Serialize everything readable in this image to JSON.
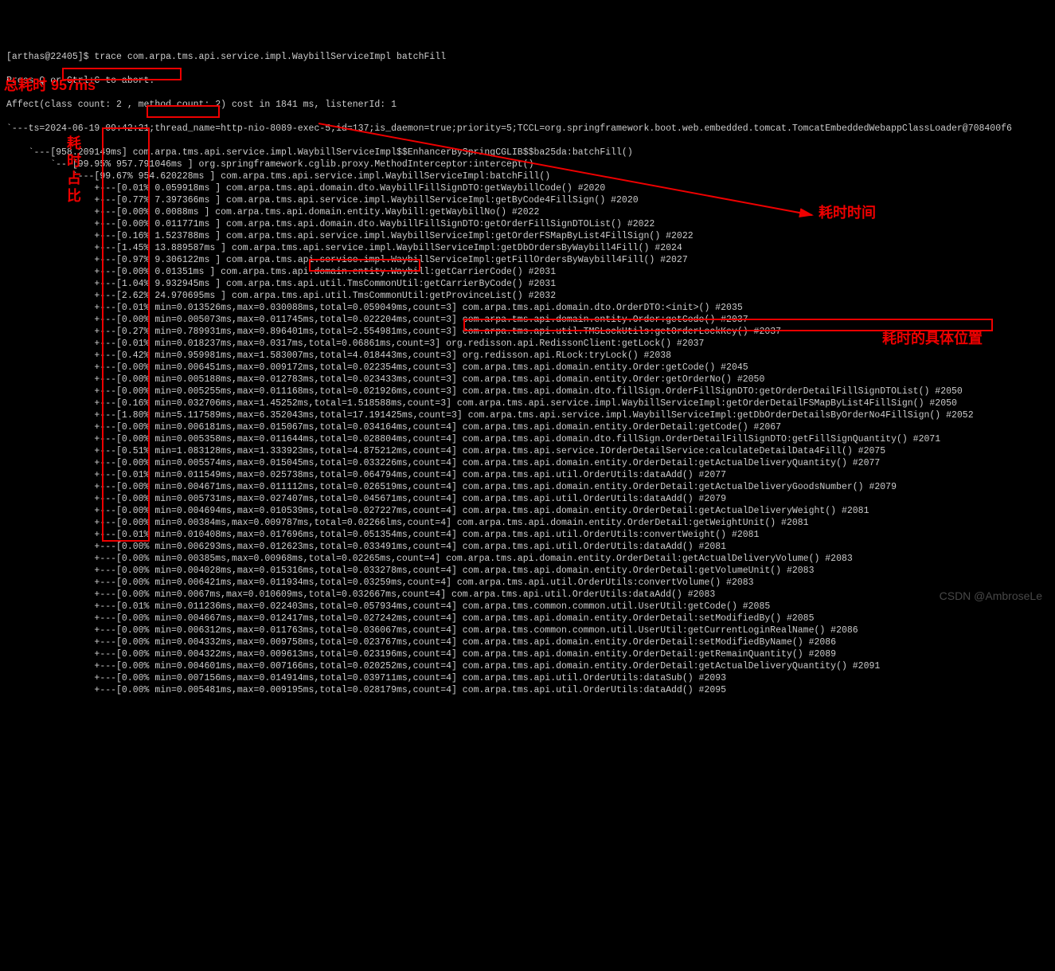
{
  "prompt": "[arthas@22405]$ trace com.arpa.tms.api.service.impl.WaybillServiceImpl batchFill",
  "abort_hint": "Press Q or Ctrl+C to abort.",
  "affect": "Affect(class count: 2 , method count: 2) cost in 1841 ms, listenerId: 1",
  "ts_line": "`---ts=2024-06-19 09:42:21;thread_name=http-nio-8089-exec-5;id=137;is_daemon=true;priority=5;TCCL=org.springframework.boot.web.embedded.tomcat.TomcatEmbeddedWebappClassLoader@708400f6",
  "lines": [
    "    `---[958.209149ms] com.arpa.tms.api.service.impl.WaybillServiceImpl$$EnhancerBySpringCGLIB$$ba25da:batchFill()",
    "        `---[99.95% 957.791046ms ] org.springframework.cglib.proxy.MethodInterceptor:intercept()",
    "            `---[99.67% 954.620228ms ] com.arpa.tms.api.service.impl.WaybillServiceImpl:batchFill()",
    "                +---[0.01% 0.059918ms ] com.arpa.tms.api.domain.dto.WaybillFillSignDTO:getWaybillCode() #2020",
    "                +---[0.77% 7.397366ms ] com.arpa.tms.api.service.impl.WaybillServiceImpl:getByCode4FillSign() #2020",
    "                +---[0.00% 0.0088ms ] com.arpa.tms.api.domain.entity.Waybill:getWaybillNo() #2022",
    "                +---[0.00% 0.011771ms ] com.arpa.tms.api.domain.dto.WaybillFillSignDTO:getOrderFillSignDTOList() #2022",
    "                +---[0.16% 1.523788ms ] com.arpa.tms.api.service.impl.WaybillServiceImpl:getOrderFSMapByList4FillSign() #2022",
    "                +---[1.45% 13.889587ms ] com.arpa.tms.api.service.impl.WaybillServiceImpl:getDbOrdersByWaybill4Fill() #2024",
    "                +---[0.97% 9.306122ms ] com.arpa.tms.api.service.impl.WaybillServiceImpl:getFillOrdersByWaybill4Fill() #2027",
    "                +---[0.00% 0.01351ms ] com.arpa.tms.api.domain.entity.Waybill:getCarrierCode() #2031",
    "                +---[1.04% 9.932945ms ] com.arpa.tms.api.util.TmsCommonUtil:getCarrierByCode() #2031",
    "                +---[2.62% 24.970695ms ] com.arpa.tms.api.util.TmsCommonUtil:getProvinceList() #2032",
    "                +---[0.01% min=0.013526ms,max=0.030088ms,total=0.059049ms,count=3] com.arpa.tms.api.domain.dto.OrderDTO:<init>() #2035",
    "                +---[0.00% min=0.005073ms,max=0.011745ms,total=0.022204ms,count=3] com.arpa.tms.api.domain.entity.Order:getCode() #2037",
    "                +---[0.27% min=0.789931ms,max=0.896401ms,total=2.554981ms,count=3] com.arpa.tms.api.util.TMSLockUtils:getOrderLockKey() #2037",
    "                +---[0.01% min=0.018237ms,max=0.0317ms,total=0.06861ms,count=3] org.redisson.api.RedissonClient:getLock() #2037",
    "                +---[0.42% min=0.959981ms,max=1.583007ms,total=4.018443ms,count=3] org.redisson.api.RLock:tryLock() #2038",
    "                +---[0.00% min=0.006451ms,max=0.009172ms,total=0.022354ms,count=3] com.arpa.tms.api.domain.entity.Order:getCode() #2045",
    "                +---[0.00% min=0.005188ms,max=0.012783ms,total=0.023433ms,count=3] com.arpa.tms.api.domain.entity.Order:getOrderNo() #2050",
    "                +---[0.00% min=0.005255ms,max=0.011168ms,total=0.021926ms,count=3] com.arpa.tms.api.domain.dto.fillSign.OrderFillSignDTO:getOrderDetailFillSignDTOList() #2050",
    "                +---[0.16% min=0.032706ms,max=1.45252ms,total=1.518588ms,count=3] com.arpa.tms.api.service.impl.WaybillServiceImpl:getOrderDetailFSMapByList4FillSign() #2050",
    "                +---[1.80% min=5.117589ms,max=6.352043ms,total=17.191425ms,count=3] com.arpa.tms.api.service.impl.WaybillServiceImpl:getDbOrderDetailsByOrderNo4FillSign() #2052",
    "                +---[0.00% min=0.006181ms,max=0.015067ms,total=0.034164ms,count=4] com.arpa.tms.api.domain.entity.OrderDetail:getCode() #2067",
    "                +---[0.00% min=0.005358ms,max=0.011644ms,total=0.028804ms,count=4] com.arpa.tms.api.domain.dto.fillSign.OrderDetailFillSignDTO:getFillSignQuantity() #2071",
    "                +---[0.51% min=1.083128ms,max=1.333923ms,total=4.875212ms,count=4] com.arpa.tms.api.service.IOrderDetailService:calculateDetailData4Fill() #2075",
    "                +---[0.00% min=0.005574ms,max=0.015045ms,total=0.033226ms,count=4] com.arpa.tms.api.domain.entity.OrderDetail:getActualDeliveryQuantity() #2077",
    "                +---[0.01% min=0.011549ms,max=0.025738ms,total=0.064794ms,count=4] com.arpa.tms.api.util.OrderUtils:dataAdd() #2077",
    "                +---[0.00% min=0.004671ms,max=0.011112ms,total=0.026519ms,count=4] com.arpa.tms.api.domain.entity.OrderDetail:getActualDeliveryGoodsNumber() #2079",
    "                +---[0.00% min=0.005731ms,max=0.027407ms,total=0.045671ms,count=4] com.arpa.tms.api.util.OrderUtils:dataAdd() #2079",
    "                +---[0.00% min=0.004694ms,max=0.010539ms,total=0.027227ms,count=4] com.arpa.tms.api.domain.entity.OrderDetail:getActualDeliveryWeight() #2081",
    "                +---[0.00% min=0.00384ms,max=0.009787ms,total=0.02266lms,count=4] com.arpa.tms.api.domain.entity.OrderDetail:getWeightUnit() #2081",
    "                +---[0.01% min=0.010408ms,max=0.017696ms,total=0.051354ms,count=4] com.arpa.tms.api.util.OrderUtils:convertWeight() #2081",
    "                +---[0.00% min=0.006293ms,max=0.012623ms,total=0.033491ms,count=4] com.arpa.tms.api.util.OrderUtils:dataAdd() #2081",
    "                +---[0.00% min=0.00385ms,max=0.00968ms,total=0.02265ms,count=4] com.arpa.tms.api.domain.entity.OrderDetail:getActualDeliveryVolume() #2083",
    "                +---[0.00% min=0.004028ms,max=0.015316ms,total=0.033278ms,count=4] com.arpa.tms.api.domain.entity.OrderDetail:getVolumeUnit() #2083",
    "                +---[0.00% min=0.006421ms,max=0.011934ms,total=0.03259ms,count=4] com.arpa.tms.api.util.OrderUtils:convertVolume() #2083",
    "                +---[0.00% min=0.0067ms,max=0.010609ms,total=0.032667ms,count=4] com.arpa.tms.api.util.OrderUtils:dataAdd() #2083",
    "                +---[0.01% min=0.011236ms,max=0.022403ms,total=0.057934ms,count=4] com.arpa.tms.common.common.util.UserUtil:getCode() #2085",
    "                +---[0.00% min=0.004667ms,max=0.012417ms,total=0.027242ms,count=4] com.arpa.tms.api.domain.entity.OrderDetail:setModifiedBy() #2085",
    "                +---[0.00% min=0.006312ms,max=0.011763ms,total=0.036067ms,count=4] com.arpa.tms.common.common.util.UserUtil:getCurrentLoginRealName() #2086",
    "                +---[0.00% min=0.004332ms,max=0.009758ms,total=0.023767ms,count=4] com.arpa.tms.api.domain.entity.OrderDetail:setModifiedByName() #2086",
    "                +---[0.00% min=0.004322ms,max=0.009613ms,total=0.023196ms,count=4] com.arpa.tms.api.domain.entity.OrderDetail:getRemainQuantity() #2089",
    "                +---[0.00% min=0.004601ms,max=0.007166ms,total=0.020252ms,count=4] com.arpa.tms.api.domain.entity.OrderDetail:getActualDeliveryQuantity() #2091",
    "                +---[0.00% min=0.007156ms,max=0.014914ms,total=0.039711ms,count=4] com.arpa.tms.api.util.OrderUtils:dataSub() #2093",
    "                +---[0.00% min=0.005481ms,max=0.009195ms,total=0.028179ms,count=4] com.arpa.tms.api.util.OrderUtils:dataAdd() #2095"
  ],
  "annotations": {
    "total_time": "总耗时 957ms",
    "pct_label": "耗时占比",
    "time_label": "耗时时间",
    "pos_label": "耗时的具体位置"
  },
  "watermark": "CSDN @AmbroseLe"
}
